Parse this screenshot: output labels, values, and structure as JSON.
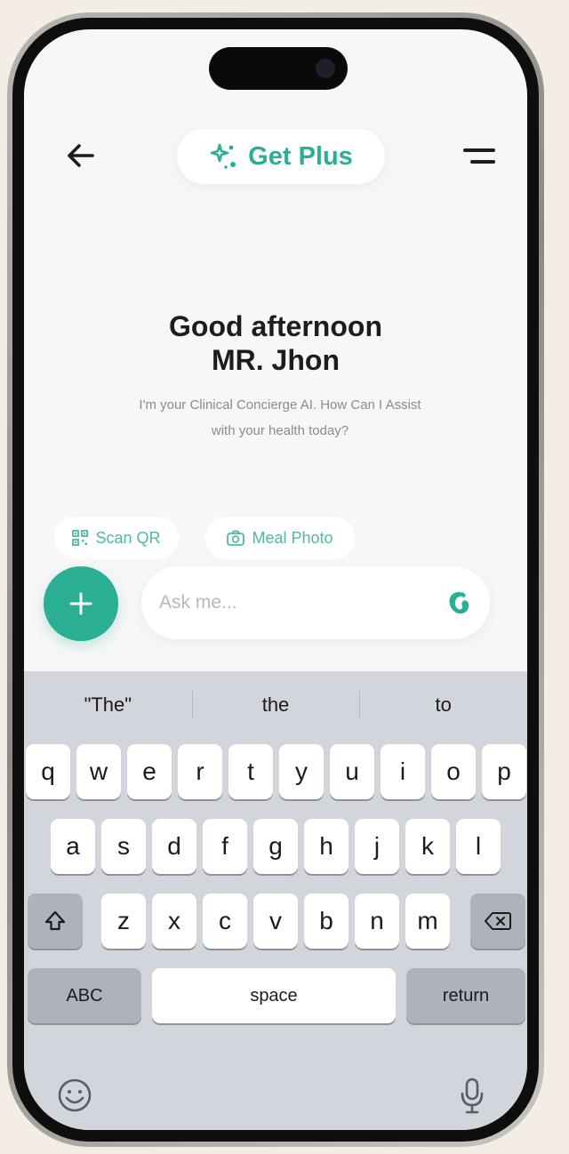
{
  "header": {
    "plus_label": "Get Plus"
  },
  "greeting": {
    "line1": "Good afternoon",
    "line2": "MR. Jhon",
    "subtitle_line1": "I'm your Clinical Concierge AI. How Can I Assist",
    "subtitle_line2": "with your health today?"
  },
  "quick_actions": [
    {
      "label": "Scan QR",
      "icon": "qr-icon"
    },
    {
      "label": "Meal Photo",
      "icon": "camera-icon"
    }
  ],
  "input": {
    "placeholder": "Ask me..."
  },
  "keyboard": {
    "suggestions": [
      "\"The\"",
      "the",
      "to"
    ],
    "row1": [
      "q",
      "w",
      "e",
      "r",
      "t",
      "y",
      "u",
      "i",
      "o",
      "p"
    ],
    "row2": [
      "a",
      "s",
      "d",
      "f",
      "g",
      "h",
      "j",
      "k",
      "l"
    ],
    "row3": [
      "z",
      "x",
      "c",
      "v",
      "b",
      "n",
      "m"
    ],
    "abc_label": "ABC",
    "space_label": "space",
    "return_label": "return"
  },
  "colors": {
    "accent": "#2aae94",
    "accent_text": "#2bae96",
    "keyboard_bg": "#d2d5db",
    "screen_bg": "#f7f7f7"
  }
}
